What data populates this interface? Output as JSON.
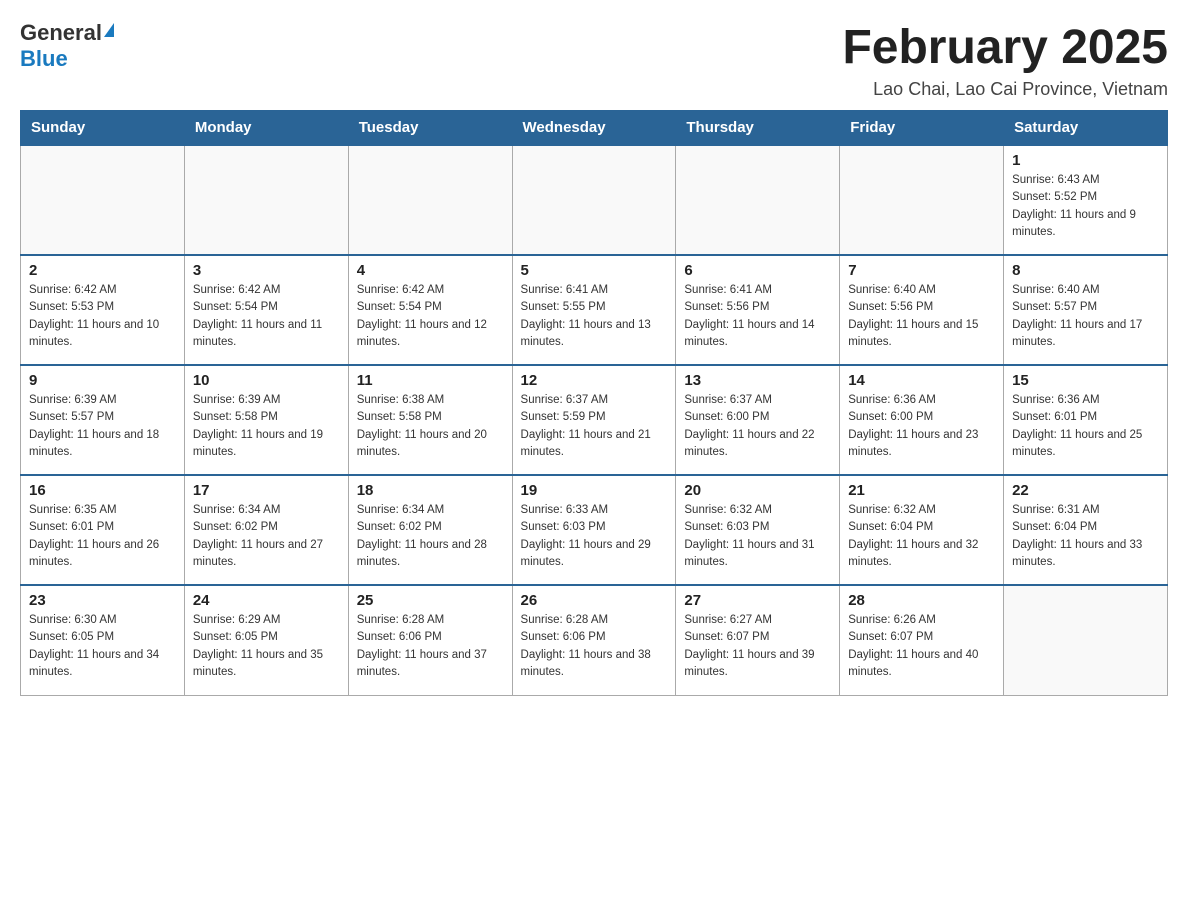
{
  "header": {
    "logo_general": "General",
    "logo_blue": "Blue",
    "month_title": "February 2025",
    "location": "Lao Chai, Lao Cai Province, Vietnam"
  },
  "weekdays": [
    "Sunday",
    "Monday",
    "Tuesday",
    "Wednesday",
    "Thursday",
    "Friday",
    "Saturday"
  ],
  "weeks": [
    [
      {
        "day": "",
        "info": ""
      },
      {
        "day": "",
        "info": ""
      },
      {
        "day": "",
        "info": ""
      },
      {
        "day": "",
        "info": ""
      },
      {
        "day": "",
        "info": ""
      },
      {
        "day": "",
        "info": ""
      },
      {
        "day": "1",
        "info": "Sunrise: 6:43 AM\nSunset: 5:52 PM\nDaylight: 11 hours and 9 minutes."
      }
    ],
    [
      {
        "day": "2",
        "info": "Sunrise: 6:42 AM\nSunset: 5:53 PM\nDaylight: 11 hours and 10 minutes."
      },
      {
        "day": "3",
        "info": "Sunrise: 6:42 AM\nSunset: 5:54 PM\nDaylight: 11 hours and 11 minutes."
      },
      {
        "day": "4",
        "info": "Sunrise: 6:42 AM\nSunset: 5:54 PM\nDaylight: 11 hours and 12 minutes."
      },
      {
        "day": "5",
        "info": "Sunrise: 6:41 AM\nSunset: 5:55 PM\nDaylight: 11 hours and 13 minutes."
      },
      {
        "day": "6",
        "info": "Sunrise: 6:41 AM\nSunset: 5:56 PM\nDaylight: 11 hours and 14 minutes."
      },
      {
        "day": "7",
        "info": "Sunrise: 6:40 AM\nSunset: 5:56 PM\nDaylight: 11 hours and 15 minutes."
      },
      {
        "day": "8",
        "info": "Sunrise: 6:40 AM\nSunset: 5:57 PM\nDaylight: 11 hours and 17 minutes."
      }
    ],
    [
      {
        "day": "9",
        "info": "Sunrise: 6:39 AM\nSunset: 5:57 PM\nDaylight: 11 hours and 18 minutes."
      },
      {
        "day": "10",
        "info": "Sunrise: 6:39 AM\nSunset: 5:58 PM\nDaylight: 11 hours and 19 minutes."
      },
      {
        "day": "11",
        "info": "Sunrise: 6:38 AM\nSunset: 5:58 PM\nDaylight: 11 hours and 20 minutes."
      },
      {
        "day": "12",
        "info": "Sunrise: 6:37 AM\nSunset: 5:59 PM\nDaylight: 11 hours and 21 minutes."
      },
      {
        "day": "13",
        "info": "Sunrise: 6:37 AM\nSunset: 6:00 PM\nDaylight: 11 hours and 22 minutes."
      },
      {
        "day": "14",
        "info": "Sunrise: 6:36 AM\nSunset: 6:00 PM\nDaylight: 11 hours and 23 minutes."
      },
      {
        "day": "15",
        "info": "Sunrise: 6:36 AM\nSunset: 6:01 PM\nDaylight: 11 hours and 25 minutes."
      }
    ],
    [
      {
        "day": "16",
        "info": "Sunrise: 6:35 AM\nSunset: 6:01 PM\nDaylight: 11 hours and 26 minutes."
      },
      {
        "day": "17",
        "info": "Sunrise: 6:34 AM\nSunset: 6:02 PM\nDaylight: 11 hours and 27 minutes."
      },
      {
        "day": "18",
        "info": "Sunrise: 6:34 AM\nSunset: 6:02 PM\nDaylight: 11 hours and 28 minutes."
      },
      {
        "day": "19",
        "info": "Sunrise: 6:33 AM\nSunset: 6:03 PM\nDaylight: 11 hours and 29 minutes."
      },
      {
        "day": "20",
        "info": "Sunrise: 6:32 AM\nSunset: 6:03 PM\nDaylight: 11 hours and 31 minutes."
      },
      {
        "day": "21",
        "info": "Sunrise: 6:32 AM\nSunset: 6:04 PM\nDaylight: 11 hours and 32 minutes."
      },
      {
        "day": "22",
        "info": "Sunrise: 6:31 AM\nSunset: 6:04 PM\nDaylight: 11 hours and 33 minutes."
      }
    ],
    [
      {
        "day": "23",
        "info": "Sunrise: 6:30 AM\nSunset: 6:05 PM\nDaylight: 11 hours and 34 minutes."
      },
      {
        "day": "24",
        "info": "Sunrise: 6:29 AM\nSunset: 6:05 PM\nDaylight: 11 hours and 35 minutes."
      },
      {
        "day": "25",
        "info": "Sunrise: 6:28 AM\nSunset: 6:06 PM\nDaylight: 11 hours and 37 minutes."
      },
      {
        "day": "26",
        "info": "Sunrise: 6:28 AM\nSunset: 6:06 PM\nDaylight: 11 hours and 38 minutes."
      },
      {
        "day": "27",
        "info": "Sunrise: 6:27 AM\nSunset: 6:07 PM\nDaylight: 11 hours and 39 minutes."
      },
      {
        "day": "28",
        "info": "Sunrise: 6:26 AM\nSunset: 6:07 PM\nDaylight: 11 hours and 40 minutes."
      },
      {
        "day": "",
        "info": ""
      }
    ]
  ]
}
